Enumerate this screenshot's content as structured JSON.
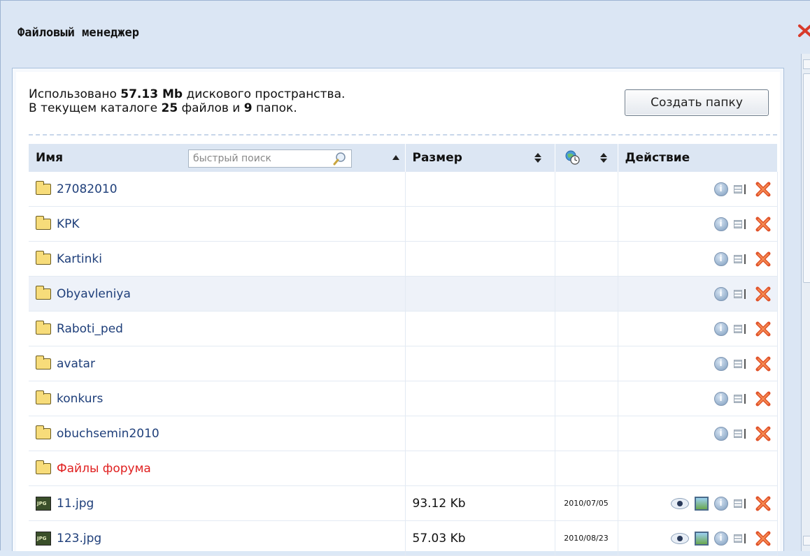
{
  "window": {
    "title": "Файловый менеджер"
  },
  "info": {
    "used_prefix": "Использовано ",
    "used_value": "57.13 Mb",
    "used_suffix": " дискового пространства.",
    "dir_prefix": "В текущем каталоге ",
    "file_count": "25",
    "dir_mid": " файлов и ",
    "folder_count": "9",
    "dir_suffix": " папок."
  },
  "toolbar": {
    "create_folder_label": "Создать папку"
  },
  "table": {
    "headers": {
      "name": "Имя",
      "size": "Размер",
      "action": "Действие"
    },
    "search_placeholder": "быстрый поиск",
    "rows": [
      {
        "type": "folder",
        "name": "27082010",
        "size": "",
        "date": "",
        "actions": [
          "info",
          "rename",
          "delete"
        ]
      },
      {
        "type": "folder",
        "name": "KPK",
        "size": "",
        "date": "",
        "actions": [
          "info",
          "rename",
          "delete"
        ]
      },
      {
        "type": "folder",
        "name": "Kartinki",
        "size": "",
        "date": "",
        "actions": [
          "info",
          "rename",
          "delete"
        ]
      },
      {
        "type": "folder",
        "name": "Obyavleniya",
        "size": "",
        "date": "",
        "actions": [
          "info",
          "rename",
          "delete"
        ]
      },
      {
        "type": "folder",
        "name": "Raboti_ped",
        "size": "",
        "date": "",
        "actions": [
          "info",
          "rename",
          "delete"
        ]
      },
      {
        "type": "folder",
        "name": "avatar",
        "size": "",
        "date": "",
        "actions": [
          "info",
          "rename",
          "delete"
        ]
      },
      {
        "type": "folder",
        "name": "konkurs",
        "size": "",
        "date": "",
        "actions": [
          "info",
          "rename",
          "delete"
        ]
      },
      {
        "type": "folder",
        "name": "obuchsemin2010",
        "size": "",
        "date": "",
        "actions": [
          "info",
          "rename",
          "delete"
        ]
      },
      {
        "type": "folder",
        "name": "Файлы форума",
        "size": "",
        "date": "",
        "actions": []
      },
      {
        "type": "file",
        "name": "11.jpg",
        "size": "93.12 Kb",
        "date": "2010/07/05",
        "actions": [
          "view",
          "image",
          "info",
          "rename",
          "delete"
        ]
      },
      {
        "type": "file",
        "name": "123.jpg",
        "size": "57.03 Kb",
        "date": "2010/08/23",
        "actions": [
          "view",
          "image",
          "info",
          "rename",
          "delete"
        ]
      }
    ]
  },
  "colors": {
    "accent_link": "#1f3f7a",
    "special_folder": "#e02020",
    "header_bg": "#dce6f3"
  }
}
